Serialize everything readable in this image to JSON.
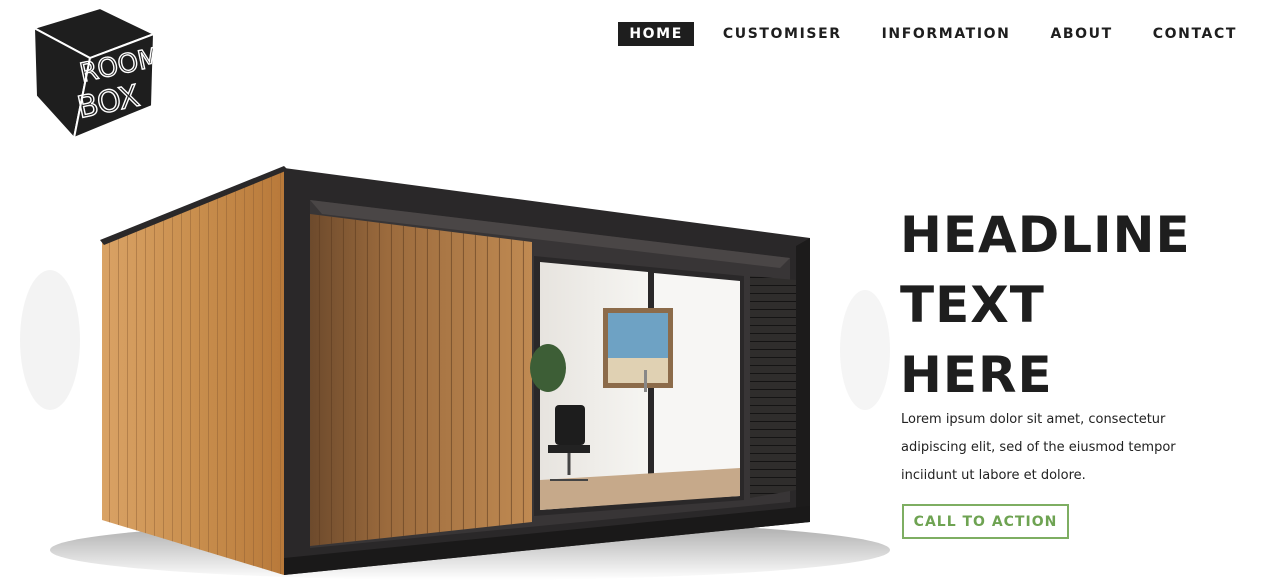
{
  "brand": {
    "logo_line1": "ROOM",
    "logo_line2": "BOX"
  },
  "nav": {
    "items": [
      {
        "label": "HOME",
        "active": true
      },
      {
        "label": "CUSTOMISER",
        "active": false
      },
      {
        "label": "INFORMATION",
        "active": false
      },
      {
        "label": "ABOUT",
        "active": false
      },
      {
        "label": "CONTACT",
        "active": false
      }
    ]
  },
  "hero": {
    "headline_lines": [
      "HEADLINE",
      "TEXT",
      "HERE"
    ],
    "body_line1": "Lorem ipsum dolor sit amet, consectetur",
    "body_line2": "adipiscing elit, sed of the eiusmod tempor",
    "body_line3": "inciidunt ut labore et dolore.",
    "cta_label": "CALL TO ACTION"
  },
  "colors": {
    "text_dark": "#1e1e1e",
    "accent_green": "#7eae62",
    "nav_active_bg": "#1e1e1e",
    "wood": "#c98f4e",
    "frame": "#2a2829"
  },
  "icons": {
    "logo": "roombox-cube-logo"
  }
}
